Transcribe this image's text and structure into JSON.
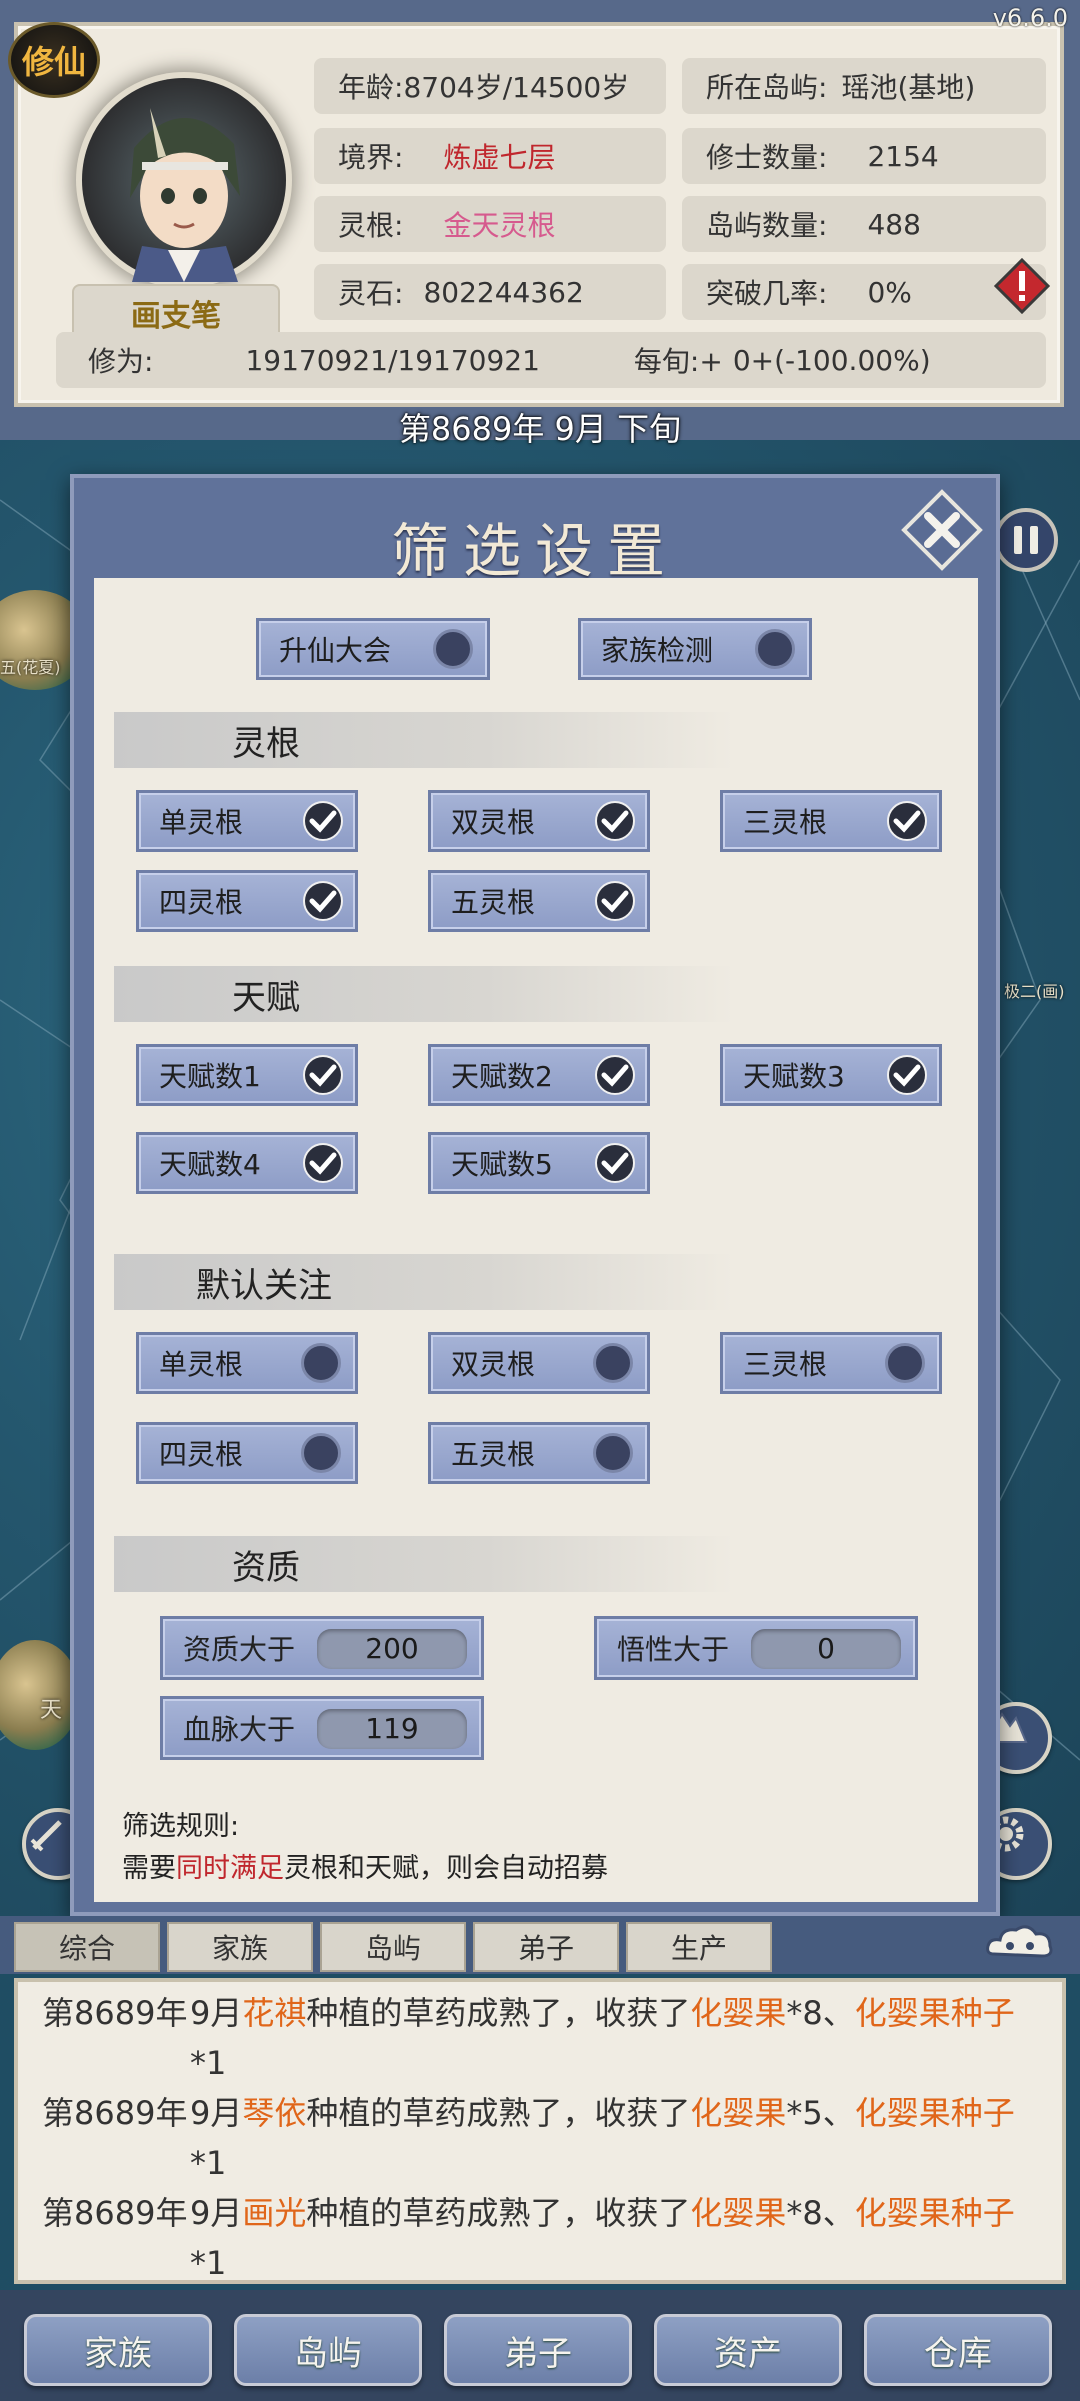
{
  "version": "v6.6.0",
  "badge": "修仙",
  "player": {
    "name": "画支笔",
    "age_label": "年龄:",
    "age_value": "8704岁/14500岁",
    "realm_label": "境界:",
    "realm_value": "炼虚七层",
    "root_label": "灵根:",
    "root_value": "金天灵根",
    "stone_label": "灵石:",
    "stone_value": "802244362",
    "island_label": "所在岛屿:",
    "island_value": "瑶池(基地)",
    "cultivators_label": "修士数量:",
    "cultivators_value": "2154",
    "islands_count_label": "岛屿数量:",
    "islands_count_value": "488",
    "breakthrough_label": "突破几率:",
    "breakthrough_value": "0%",
    "cultivation_label": "修为:",
    "cultivation_value": "19170921/19170921",
    "per_period_label": "每旬:+",
    "per_period_value": "0+(-100.00%)"
  },
  "date": "第8689年 9月 下旬",
  "map_labels": {
    "island_left": "五(花夏)",
    "island_right": "极二(画)",
    "island_bottom": "天"
  },
  "dialog": {
    "title": "筛选设置",
    "top_toggles": [
      {
        "label": "升仙大会",
        "checked": false
      },
      {
        "label": "家族检测",
        "checked": false
      }
    ],
    "sections": {
      "root": "灵根",
      "talent": "天赋",
      "follow": "默认关注",
      "aptitude": "资质"
    },
    "root_options": [
      {
        "label": "单灵根",
        "checked": true
      },
      {
        "label": "双灵根",
        "checked": true
      },
      {
        "label": "三灵根",
        "checked": true
      },
      {
        "label": "四灵根",
        "checked": true
      },
      {
        "label": "五灵根",
        "checked": true
      }
    ],
    "talent_options": [
      {
        "label": "天赋数1",
        "checked": true
      },
      {
        "label": "天赋数2",
        "checked": true
      },
      {
        "label": "天赋数3",
        "checked": true
      },
      {
        "label": "天赋数4",
        "checked": true
      },
      {
        "label": "天赋数5",
        "checked": true
      }
    ],
    "follow_options": [
      {
        "label": "单灵根",
        "checked": false
      },
      {
        "label": "双灵根",
        "checked": false
      },
      {
        "label": "三灵根",
        "checked": false
      },
      {
        "label": "四灵根",
        "checked": false
      },
      {
        "label": "五灵根",
        "checked": false
      }
    ],
    "aptitude_fields": [
      {
        "label": "资质大于",
        "value": "200"
      },
      {
        "label": "悟性大于",
        "value": "0"
      },
      {
        "label": "血脉大于",
        "value": "119"
      }
    ],
    "rule_title": "筛选规则:",
    "rule_prefix": "需要",
    "rule_highlight": "同时满足",
    "rule_suffix": "灵根和天赋，则会自动招募"
  },
  "log_tabs": [
    "综合",
    "家族",
    "岛屿",
    "弟子",
    "生产"
  ],
  "log_entries": [
    {
      "year": "第8689年",
      "month": "9月",
      "person": "花褀",
      "text1": "种植的草药成熟了，收获了",
      "item1": "化婴果",
      "count1": "*8、",
      "item2": "化婴果种子",
      "count2": "*1"
    },
    {
      "year": "第8689年",
      "month": "9月",
      "person": "琴依",
      "text1": "种植的草药成熟了，收获了",
      "item1": "化婴果",
      "count1": "*5、",
      "item2": "化婴果种子",
      "count2": "*1"
    },
    {
      "year": "第8689年",
      "month": "9月",
      "person": "画光",
      "text1": "种植的草药成熟了，收获了",
      "item1": "化婴果",
      "count1": "*8、",
      "item2": "化婴果种子",
      "count2": "*1"
    }
  ],
  "bottom_nav": [
    "家族",
    "岛屿",
    "弟子",
    "资产",
    "仓库"
  ],
  "colors": {
    "accent_red": "#c0272d",
    "root_pink": "#d65a8e",
    "log_highlight": "#e0661a",
    "name_gold": "#8b6a14"
  }
}
